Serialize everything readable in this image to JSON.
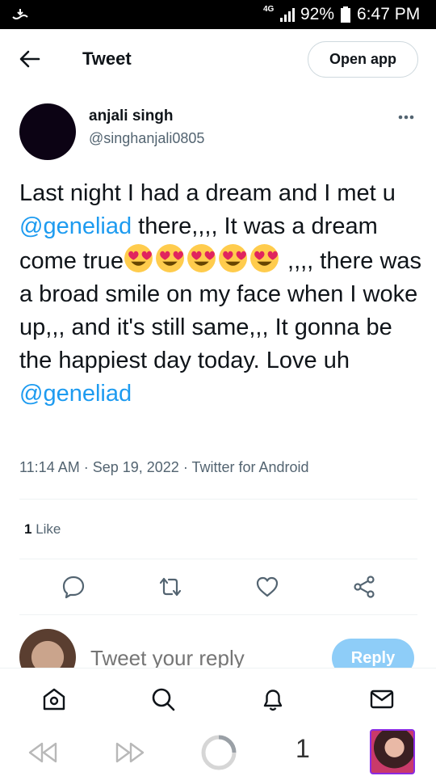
{
  "status_bar": {
    "network": "4G",
    "battery": "92%",
    "time": "6:47 PM"
  },
  "header": {
    "title": "Tweet",
    "open_app_label": "Open app"
  },
  "tweet": {
    "author_name": "anjali singh",
    "author_handle": "@singhanjali0805",
    "text": {
      "seg1": "Last night I had a dream and I met u ",
      "mention1": "@geneliad",
      "seg2": " there,,,, It was a dream come true",
      "seg3": " ,,,, there was a broad smile on my face when I woke up,,, and it's still same,,, It gonna be the happiest day today. Love uh ",
      "mention2": "@geneliad"
    },
    "emoji_count_name": "heart-eyes-emoji",
    "time": "11:14 AM",
    "date": "Sep 19, 2022",
    "source": "Twitter for Android",
    "meta_separator": " · ",
    "likes_count": "1",
    "likes_label": "Like"
  },
  "reply": {
    "placeholder": "Tweet your reply",
    "button_label": "Reply"
  },
  "actions": [
    "reply-icon",
    "retweet-icon",
    "like-icon",
    "share-icon"
  ],
  "bottom_nav": [
    "home-icon",
    "search-icon",
    "notifications-icon",
    "messages-icon"
  ],
  "browser": {
    "tab_count": "1"
  },
  "colors": {
    "accent": "#1d9bf0",
    "text": "#0f1419",
    "muted": "#536471",
    "reply_button": "#8ecdf8"
  }
}
